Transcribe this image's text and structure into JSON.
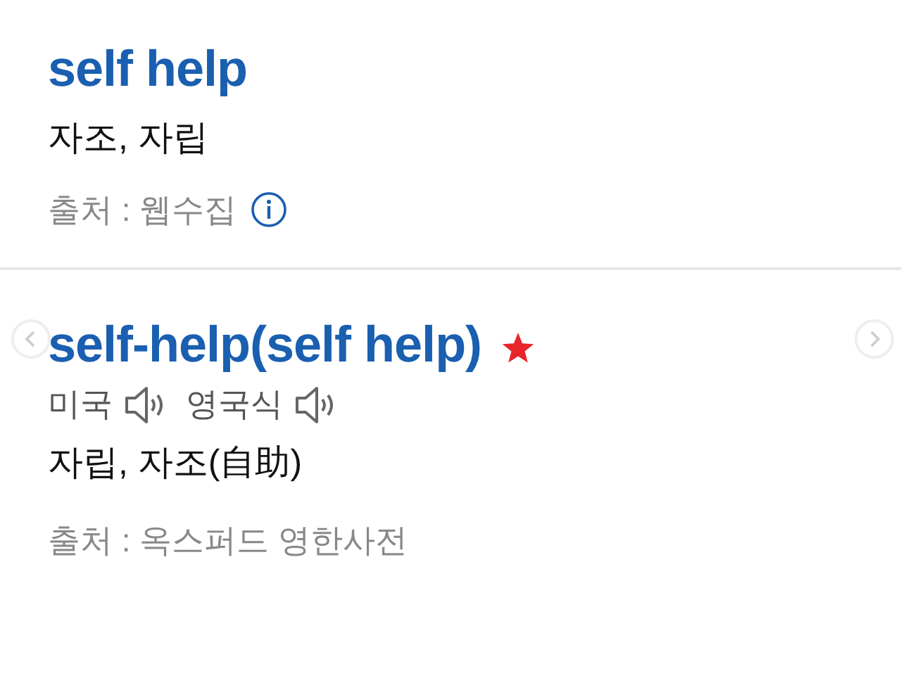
{
  "entries": [
    {
      "headword": "self help",
      "starred": false,
      "meaning": "자조, 자립",
      "source": "출처 : 웹수집",
      "source_info": true
    },
    {
      "headword": "self-help(self help)",
      "starred": true,
      "pronunciations": [
        "미국",
        "영국식"
      ],
      "meaning": "자립, 자조(自助)",
      "source": "출처 : 옥스퍼드 영한사전",
      "source_info": false
    }
  ]
}
